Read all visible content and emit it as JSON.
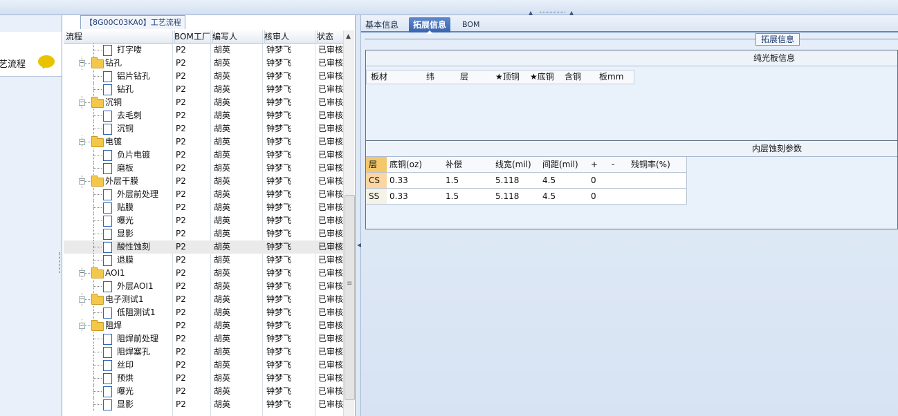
{
  "left_panel": {
    "title": "艺流程"
  },
  "middle_panel": {
    "tab_label": "【8G00C03KA0】工艺流程",
    "columns": [
      "流程",
      "BOM工厂",
      "编写人",
      "核审人",
      "状态"
    ],
    "rows": [
      {
        "name": "打字喽",
        "type": "doc",
        "bom": "P2",
        "writer": "胡英",
        "reviewer": "钟梦飞",
        "status": "已审核"
      },
      {
        "name": "钻孔",
        "type": "folder",
        "bom": "P2",
        "writer": "胡英",
        "reviewer": "钟梦飞",
        "status": "已审核"
      },
      {
        "name": "铝片钻孔",
        "type": "doc",
        "bom": "P2",
        "writer": "胡英",
        "reviewer": "钟梦飞",
        "status": "已审核"
      },
      {
        "name": "钻孔",
        "type": "doc",
        "bom": "P2",
        "writer": "胡英",
        "reviewer": "钟梦飞",
        "status": "已审核"
      },
      {
        "name": "沉铜",
        "type": "folder",
        "bom": "P2",
        "writer": "胡英",
        "reviewer": "钟梦飞",
        "status": "已审核"
      },
      {
        "name": "去毛刺",
        "type": "doc",
        "bom": "P2",
        "writer": "胡英",
        "reviewer": "钟梦飞",
        "status": "已审核"
      },
      {
        "name": "沉铜",
        "type": "doc",
        "bom": "P2",
        "writer": "胡英",
        "reviewer": "钟梦飞",
        "status": "已审核"
      },
      {
        "name": "电镀",
        "type": "folder",
        "bom": "P2",
        "writer": "胡英",
        "reviewer": "钟梦飞",
        "status": "已审核"
      },
      {
        "name": "负片电镀",
        "type": "doc",
        "bom": "P2",
        "writer": "胡英",
        "reviewer": "钟梦飞",
        "status": "已审核"
      },
      {
        "name": "磨板",
        "type": "doc",
        "bom": "P2",
        "writer": "胡英",
        "reviewer": "钟梦飞",
        "status": "已审核"
      },
      {
        "name": "外层干膜",
        "type": "folder",
        "bom": "P2",
        "writer": "胡英",
        "reviewer": "钟梦飞",
        "status": "已审核"
      },
      {
        "name": "外层前处理",
        "type": "doc",
        "bom": "P2",
        "writer": "胡英",
        "reviewer": "钟梦飞",
        "status": "已审核"
      },
      {
        "name": "贴膜",
        "type": "doc",
        "bom": "P2",
        "writer": "胡英",
        "reviewer": "钟梦飞",
        "status": "已审核"
      },
      {
        "name": "曝光",
        "type": "doc",
        "bom": "P2",
        "writer": "胡英",
        "reviewer": "钟梦飞",
        "status": "已审核"
      },
      {
        "name": "显影",
        "type": "doc",
        "bom": "P2",
        "writer": "胡英",
        "reviewer": "钟梦飞",
        "status": "已审核"
      },
      {
        "name": "酸性蚀刻",
        "type": "doc",
        "bom": "P2",
        "writer": "胡英",
        "reviewer": "钟梦飞",
        "status": "已审核",
        "selected": true
      },
      {
        "name": "退膜",
        "type": "doc",
        "bom": "P2",
        "writer": "胡英",
        "reviewer": "钟梦飞",
        "status": "已审核"
      },
      {
        "name": "AOI1",
        "type": "folder",
        "bom": "P2",
        "writer": "胡英",
        "reviewer": "钟梦飞",
        "status": "已审核"
      },
      {
        "name": "外层AOI1",
        "type": "doc",
        "bom": "P2",
        "writer": "胡英",
        "reviewer": "钟梦飞",
        "status": "已审核"
      },
      {
        "name": "电子测试1",
        "type": "folder",
        "bom": "P2",
        "writer": "胡英",
        "reviewer": "钟梦飞",
        "status": "已审核"
      },
      {
        "name": "低阻测试1",
        "type": "doc",
        "bom": "P2",
        "writer": "胡英",
        "reviewer": "钟梦飞",
        "status": "已审核"
      },
      {
        "name": "阻焊",
        "type": "folder",
        "bom": "P2",
        "writer": "胡英",
        "reviewer": "钟梦飞",
        "status": "已审核"
      },
      {
        "name": "阻焊前处理",
        "type": "doc",
        "bom": "P2",
        "writer": "胡英",
        "reviewer": "钟梦飞",
        "status": "已审核"
      },
      {
        "name": "阻焊塞孔",
        "type": "doc",
        "bom": "P2",
        "writer": "胡英",
        "reviewer": "钟梦飞",
        "status": "已审核"
      },
      {
        "name": "丝印",
        "type": "doc",
        "bom": "P2",
        "writer": "胡英",
        "reviewer": "钟梦飞",
        "status": "已审核"
      },
      {
        "name": "预烘",
        "type": "doc",
        "bom": "P2",
        "writer": "胡英",
        "reviewer": "钟梦飞",
        "status": "已审核"
      },
      {
        "name": "曝光",
        "type": "doc",
        "bom": "P2",
        "writer": "胡英",
        "reviewer": "钟梦飞",
        "status": "已审核"
      },
      {
        "name": "显影",
        "type": "doc",
        "bom": "P2",
        "writer": "胡英",
        "reviewer": "钟梦飞",
        "status": "已审核"
      }
    ]
  },
  "right_panel": {
    "tabs": [
      {
        "label": "基本信息",
        "active": false
      },
      {
        "label": "拓展信息",
        "active": true
      },
      {
        "label": "BOM",
        "active": false
      }
    ],
    "extension_title": "拓展信息",
    "plain_board": {
      "title": "纯光板信息",
      "columns": [
        "板材",
        "纬",
        "层",
        "★顶铜",
        "★底铜",
        "含铜",
        "板mm"
      ]
    },
    "inner_etch": {
      "title": "内层蚀刻参数",
      "columns": [
        "层",
        "底铜(oz)",
        "补偿",
        "线宽(mil)",
        "间距(mil)",
        "+",
        "-",
        "残铜率(%)"
      ],
      "rows": [
        [
          "CS",
          "0.33",
          "1.5",
          "5.118",
          "4.5",
          "0",
          "",
          ""
        ],
        [
          "SS",
          "0.33",
          "1.5",
          "5.118",
          "4.5",
          "0",
          "",
          ""
        ]
      ]
    }
  },
  "colors": {
    "accent": "#3763ae",
    "folder": "#f3c74a",
    "selected_row": "#eaeaea"
  }
}
